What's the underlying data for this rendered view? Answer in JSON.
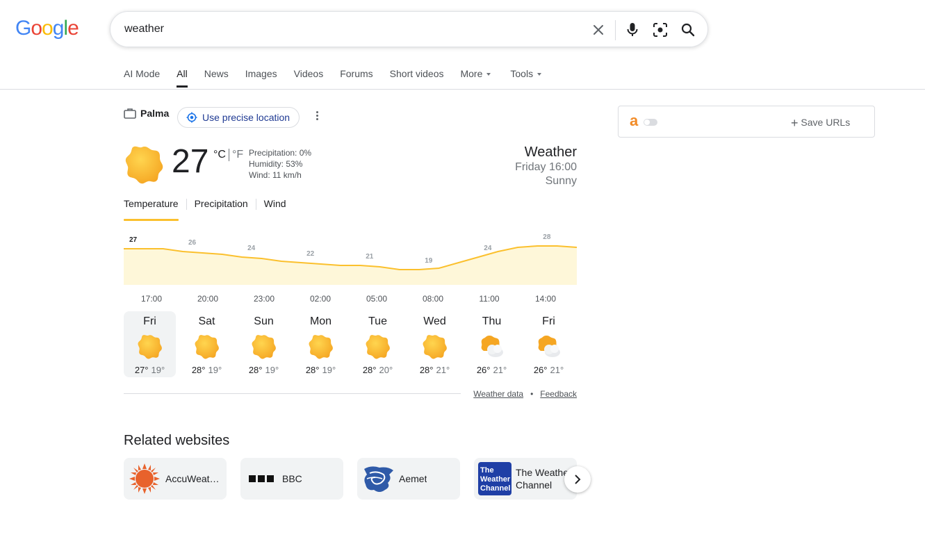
{
  "search": {
    "logo": "Google",
    "query": "weather"
  },
  "tabs": [
    {
      "label": "AI Mode"
    },
    {
      "label": "All",
      "active": true
    },
    {
      "label": "News"
    },
    {
      "label": "Images"
    },
    {
      "label": "Videos"
    },
    {
      "label": "Forums"
    },
    {
      "label": "Short videos"
    },
    {
      "label": "More",
      "dropdown": true
    },
    {
      "label": "Tools",
      "dropdown": true
    }
  ],
  "location": {
    "name": "Palma",
    "precise_label": "Use precise location"
  },
  "current": {
    "temp": "27",
    "unit_c": "°C",
    "unit_f": "°F",
    "precipitation": "Precipitation: 0%",
    "humidity": "Humidity: 53%",
    "wind": "Wind: 11 km/h",
    "title": "Weather",
    "time": "Friday 16:00",
    "condition": "Sunny"
  },
  "weather_tabs": [
    "Temperature",
    "Precipitation",
    "Wind"
  ],
  "chart_data": {
    "type": "area",
    "x": [
      "17:00",
      "18:00",
      "19:00",
      "20:00",
      "21:00",
      "22:00",
      "23:00",
      "00:00",
      "01:00",
      "02:00",
      "03:00",
      "04:00",
      "05:00",
      "06:00",
      "07:00",
      "08:00",
      "09:00",
      "10:00",
      "11:00",
      "12:00",
      "13:00",
      "14:00",
      "15:00",
      "16:00"
    ],
    "values": [
      27,
      27,
      27,
      26,
      25.5,
      25,
      24,
      23.5,
      22.5,
      22,
      21.5,
      21,
      21,
      20.5,
      19.5,
      19.5,
      20,
      22,
      24,
      26,
      27.5,
      28,
      28,
      27.5
    ],
    "labels": [
      {
        "hour": "17:00",
        "value": "27"
      },
      {
        "hour": "20:00",
        "value": "26"
      },
      {
        "hour": "23:00",
        "value": "24"
      },
      {
        "hour": "02:00",
        "value": "22"
      },
      {
        "hour": "05:00",
        "value": "21"
      },
      {
        "hour": "08:00",
        "value": "19"
      },
      {
        "hour": "11:00",
        "value": "24"
      },
      {
        "hour": "14:00",
        "value": "28"
      }
    ],
    "tick_labels": [
      "17:00",
      "20:00",
      "23:00",
      "02:00",
      "05:00",
      "08:00",
      "11:00",
      "14:00"
    ],
    "line_color": "#fbc02d",
    "fill_color": "#fef7d9"
  },
  "forecast": [
    {
      "day": "Fri",
      "icon": "sun-icon",
      "high": "27°",
      "low": "19°",
      "selected": true
    },
    {
      "day": "Sat",
      "icon": "sun-icon",
      "high": "28°",
      "low": "19°"
    },
    {
      "day": "Sun",
      "icon": "sun-icon",
      "high": "28°",
      "low": "19°"
    },
    {
      "day": "Mon",
      "icon": "sun-icon",
      "high": "28°",
      "low": "19°"
    },
    {
      "day": "Tue",
      "icon": "sun-icon",
      "high": "28°",
      "low": "20°"
    },
    {
      "day": "Wed",
      "icon": "sun-icon",
      "high": "28°",
      "low": "21°"
    },
    {
      "day": "Thu",
      "icon": "partly-cloudy-icon",
      "high": "26°",
      "low": "21°"
    },
    {
      "day": "Fri",
      "icon": "partly-cloudy-icon",
      "high": "26°",
      "low": "21°"
    }
  ],
  "footer": {
    "weather_data": "Weather data",
    "dot": "•",
    "feedback": "Feedback"
  },
  "related": {
    "title": "Related websites",
    "sites": [
      {
        "name": "AccuWeat…",
        "icon": "accuweather-logo"
      },
      {
        "name": "BBC",
        "icon": "bbc-logo"
      },
      {
        "name": "Aemet",
        "icon": "aemet-logo"
      },
      {
        "name": "The Weather Channel",
        "icon": "weather-channel-logo",
        "logo_text": "The Weather Channel"
      }
    ]
  },
  "extension": {
    "letter": "a",
    "save_label": "Save URLs"
  },
  "colors": {
    "accent": "#fbc02d",
    "link": "#1a0dab",
    "ext_orange": "#f28c28"
  }
}
